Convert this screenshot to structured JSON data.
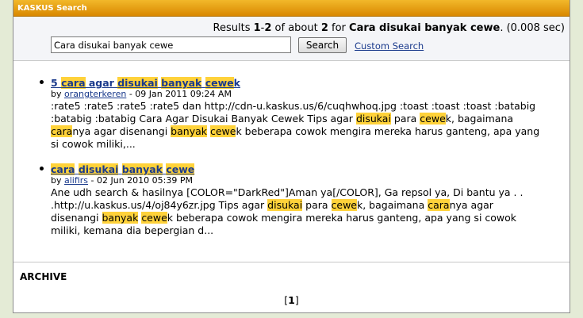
{
  "header": {
    "title": "KASKUS Search"
  },
  "search": {
    "results_prefix": "Results ",
    "range_start": "1",
    "range_sep": "-",
    "range_end": "2",
    "of_about": " of about ",
    "total": "2",
    "for_word": " for ",
    "query_bold": "Cara disukai banyak cewe",
    "timing": ". (0.008 sec)",
    "query_value": "Cara disukai banyak cewe",
    "button_label": "Search",
    "custom_search_label": "Custom Search"
  },
  "results": [
    {
      "title_parts": [
        "5 ",
        "cara",
        " agar ",
        "disukai",
        " ",
        "banyak",
        " ",
        "cewe",
        "k"
      ],
      "by": "by ",
      "author": "orangterkeren",
      "date": " - 09 Jan 2011 09:24 AM",
      "snippet_lines": [
        [
          ":rate5 :rate5 :rate5 :rate5 dan http://cdn-u.kaskus.us/6/cuqhwhoq.jpg :toast :toast :toast :batabig"
        ],
        [
          ":batabig :batabig Cara Agar Disukai Banyak Cewek Tips agar ",
          "disukai",
          " para ",
          "cewe",
          "k, bagaimana"
        ],
        [
          "",
          "cara",
          "nya agar disenangi ",
          "banyak",
          " ",
          "cewe",
          "k beberapa cowok mengira mereka harus ganteng, apa yang"
        ],
        [
          "si cowok miliki,..."
        ]
      ]
    },
    {
      "title_parts": [
        "",
        "cara",
        " ",
        "disukai",
        " ",
        "banyak",
        " ",
        "cewe",
        ""
      ],
      "by": "by ",
      "author": "alifirs",
      "date": " - 02 Jun 2010 05:39 PM",
      "snippet_lines": [
        [
          "Ane udh search & hasilnya [COLOR=\"DarkRed\"]Aman ya[/COLOR], Ga repsol ya, Di bantu ya . ."
        ],
        [
          ".http://u.kaskus.us/4/oj84y6zr.jpg Tips agar ",
          "disukai",
          " para ",
          "cewe",
          "k, bagaimana ",
          "cara",
          "nya agar"
        ],
        [
          "disenangi ",
          "banyak",
          " ",
          "cewe",
          "k beberapa cowok mengira mereka harus ganteng, apa yang si cowok"
        ],
        [
          "miliki, kemana dia bepergian d..."
        ]
      ]
    }
  ],
  "archive_label": "ARCHIVE",
  "pager": {
    "open": "[",
    "current": "1",
    "close": "]"
  },
  "colors": {
    "titlebar": "#e49a00",
    "highlight": "#ffd23a",
    "link": "#1a3a8c"
  }
}
